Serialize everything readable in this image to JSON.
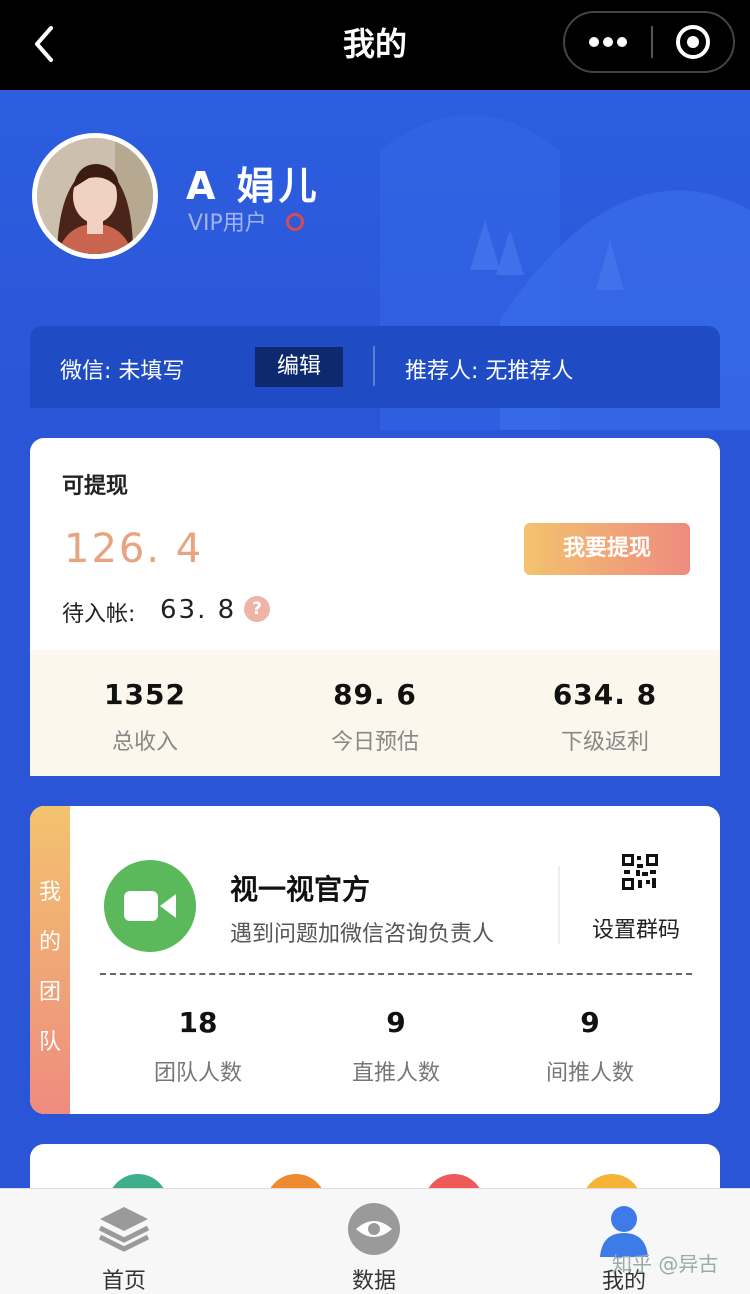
{
  "nav": {
    "title": "我的"
  },
  "profile": {
    "name": "A 娟儿",
    "level": "VIP用户"
  },
  "wechat": {
    "info": "微信: 未填写",
    "edit_label": "编辑",
    "referrer": "推荐人: 无推荐人"
  },
  "balance": {
    "withdrawable_label": "可提现",
    "amount": "126. 4",
    "withdraw_button": "我要提现",
    "pending_label": "待入帐:",
    "pending_value": "63. 8",
    "help": "?",
    "stats": [
      {
        "value": "1352",
        "label": "总收入"
      },
      {
        "value": "89. 6",
        "label": "今日预估"
      },
      {
        "value": "634. 8",
        "label": "下级返利"
      }
    ]
  },
  "team": {
    "tag_chars": [
      "我",
      "的",
      "团",
      "队"
    ],
    "group_name": "视一视官方",
    "group_desc": "遇到问题加微信咨询负责人",
    "set_qr_label": "设置群码",
    "stats": [
      {
        "value": "18",
        "label": "团队人数"
      },
      {
        "value": "9",
        "label": "直推人数"
      },
      {
        "value": "9",
        "label": "间推人数"
      }
    ]
  },
  "menu": {
    "colors": [
      "#3fae8c",
      "#f08a2e",
      "#ee5a5a",
      "#f5b338"
    ]
  },
  "tabbar": {
    "tabs": [
      {
        "label": "首页",
        "icon": "layers-icon"
      },
      {
        "label": "数据",
        "icon": "eye-icon"
      },
      {
        "label": "我的",
        "icon": "person-icon",
        "active": true
      }
    ]
  },
  "watermark": "知乎 @异古",
  "colors": {
    "brand_blue": "#2a55d6",
    "accent_orange": "#e8a47f",
    "active_tab": "#3d7be8"
  }
}
